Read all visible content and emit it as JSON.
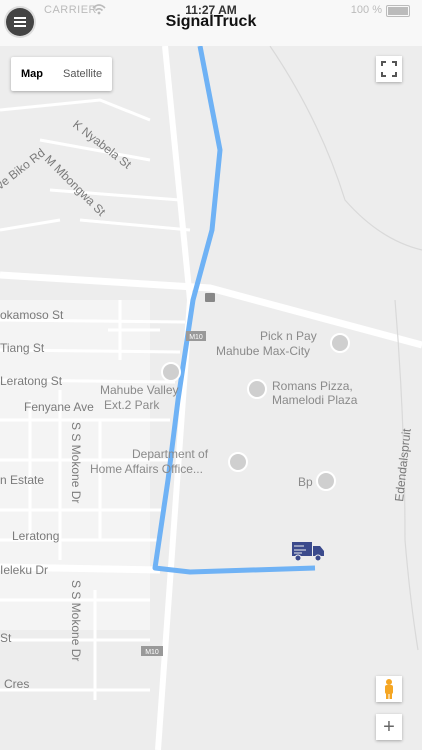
{
  "status": {
    "carrier": "CARRIER",
    "time": "11:27 AM",
    "battery": "100 %"
  },
  "app": {
    "title": "SignalTruck"
  },
  "map_controls": {
    "map_label": "Map",
    "satellite_label": "Satellite",
    "zoom_in_label": "+"
  },
  "streets": {
    "k_nyabela": "K Nyabela St",
    "biko": "ve Biko Rd",
    "mbongwa": "M Mbongwa St",
    "okamoso": "okamoso St",
    "tiang": "Tiang St",
    "leratong1": "Leratong St",
    "fenyane": "Fenyane Ave",
    "mokone1": "S S Mokone Dr",
    "estate": "n Estate",
    "leratong2": "Leratong",
    "ieleku": "Ieleku Dr",
    "mokone2": "S S Mokone Dr",
    "st": "St",
    "cres": "Cres",
    "edendalspruit": "Edendalspruit",
    "m10_a": "M10",
    "m10_b": "M10"
  },
  "pois": {
    "picknpay_1": "Pick n Pay",
    "picknpay_2": "Mahube Max-City",
    "mahube_1": "Mahube Valley",
    "mahube_2": "Ext.2 Park",
    "romans_1": "Romans Pizza,",
    "romans_2": "Mamelodi Plaza",
    "home_affairs_1": "Department of",
    "home_affairs_2": "Home Affairs Office...",
    "bp": "Bp"
  },
  "colors": {
    "route": "#6fb2f5",
    "truck": "#3b4a8c"
  },
  "icons": [
    "menu-icon",
    "wifi-icon",
    "battery-icon",
    "fullscreen-icon",
    "truck-icon",
    "pegman-icon"
  ]
}
